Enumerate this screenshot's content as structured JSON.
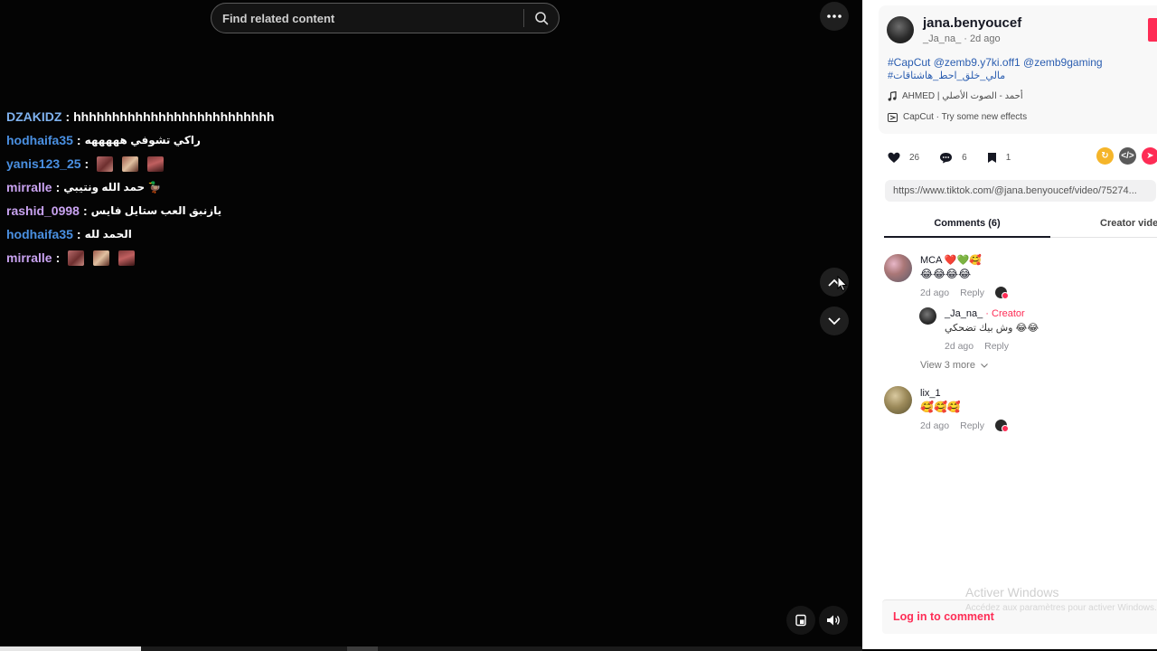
{
  "search": {
    "placeholder": "Find related content"
  },
  "chat": [
    {
      "user": "DZAKIDZ",
      "color": "#7fb2ef",
      "message": "hhhhhhhhhhhhhhhhhhhhhhhhhh",
      "emotes": 0
    },
    {
      "user": "hodhaifa35",
      "color": "#4a90e2",
      "message": "راكي تشوفي هههههه",
      "emotes": 0
    },
    {
      "user": "yanis123_25",
      "color": "#4a90e2",
      "message": "",
      "emotes": 3
    },
    {
      "user": "mirralle",
      "color": "#c8a2f0",
      "message": "حمد الله ونتيبي 🦆",
      "emotes": 0
    },
    {
      "user": "rashid_0998",
      "color": "#c8a2f0",
      "message": "يازنبق العب ستايل فايس",
      "emotes": 0
    },
    {
      "user": "hodhaifa35",
      "color": "#4a90e2",
      "message": "الحمد لله",
      "emotes": 0
    },
    {
      "user": "mirralle",
      "color": "#c8a2f0",
      "message": "",
      "emotes": 3
    }
  ],
  "video_controls": {
    "more_icon": "more-horizontal-icon",
    "up_icon": "chevron-up-icon",
    "down_icon": "chevron-down-icon",
    "pip_icon": "picture-in-picture-icon",
    "volume_icon": "volume-icon"
  },
  "post": {
    "author_name": "jana.benyoucef",
    "author_sub": "_Ja_na_ · 2d ago",
    "caption_tags": "#CapCut @zemb9.y7ki.off1 @zemb9gaming",
    "caption_arabic": "#مالي_خلق_احط_هاشتاقات",
    "music": "AHMED | أحمد - الصوت الأصلي",
    "effect": "CapCut · Try some new effects"
  },
  "actions": {
    "likes": "26",
    "comments": "6",
    "saves": "1"
  },
  "share_colors": [
    "#f5b52a",
    "#5a5a5a",
    "#fe2c55"
  ],
  "link": "https://www.tiktok.com/@jana.benyoucef/video/75274...",
  "tabs": {
    "comments": "Comments (6)",
    "creator": "Creator videos"
  },
  "comments": [
    {
      "name": "MCA ❤️💚🥰",
      "text": "😂😂😂😂",
      "time": "2d ago",
      "reply": "Reply"
    },
    {
      "name": "lix_1",
      "text": "🥰🥰🥰",
      "time": "2d ago",
      "reply": "Reply"
    }
  ],
  "reply": {
    "name": "_Ja_na_",
    "badge": "· Creator",
    "text": "وش بيك تضحكي 😂😂",
    "time": "2d ago",
    "reply": "Reply"
  },
  "view_more": "View 3 more",
  "activate": {
    "title": "Activer Windows",
    "sub": "Accédez aux paramètres pour activer Windows."
  },
  "login": "Log in to comment"
}
